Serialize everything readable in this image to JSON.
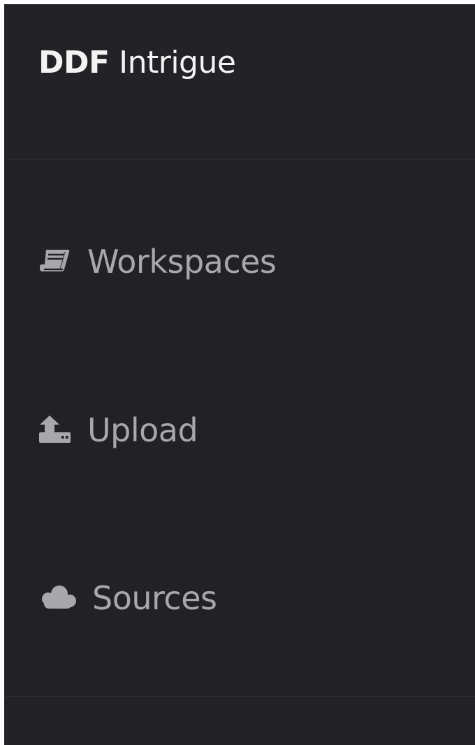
{
  "app": {
    "brand_bold": "DDF",
    "brand_light": "Intrigue"
  },
  "nav": {
    "items": [
      {
        "label": "Workspaces",
        "icon": "book-icon"
      },
      {
        "label": "Upload",
        "icon": "upload-icon"
      },
      {
        "label": "Sources",
        "icon": "cloud-icon"
      }
    ]
  },
  "colors": {
    "background": "#222226",
    "brand_text": "#f3f3f3",
    "nav_text": "#a8a8ab",
    "divider": "#2e2e33"
  }
}
